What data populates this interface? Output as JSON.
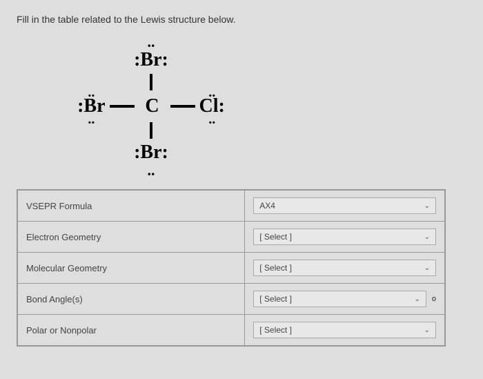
{
  "instruction": "Fill in the table related to the Lewis structure below.",
  "lewis": {
    "top": ":Br:",
    "left": ":Br",
    "center": "C",
    "right": "Cl:",
    "bottom": ":Br:",
    "lp_top": "..",
    "lp_bottom": "..",
    "lp_left_top": "..",
    "lp_left_bottom": "..",
    "lp_right_top": "..",
    "lp_right_bottom": ".."
  },
  "table": {
    "rows": [
      {
        "label": "VSEPR Formula",
        "value": "AX4",
        "annotation": ""
      },
      {
        "label": "Electron Geometry",
        "value": "[ Select ]",
        "annotation": ""
      },
      {
        "label": "Molecular Geometry",
        "value": "[ Select ]",
        "annotation": ""
      },
      {
        "label": "Bond Angle(s)",
        "value": "[ Select ]",
        "annotation": "o"
      },
      {
        "label": "Polar or Nonpolar",
        "value": "[ Select ]",
        "annotation": ""
      }
    ]
  },
  "icons": {
    "caret": "⌄"
  }
}
